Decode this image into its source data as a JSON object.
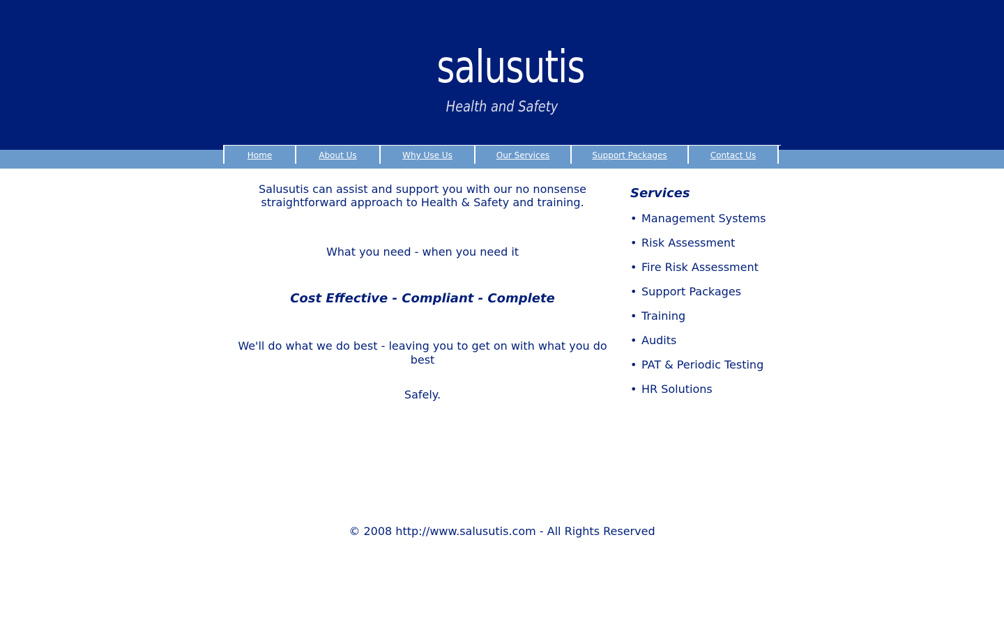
{
  "brand": {
    "logo_text": "salusutis",
    "logo_subtitle": "Health and Safety"
  },
  "nav": {
    "items": [
      {
        "label": "Home"
      },
      {
        "label": "About Us"
      },
      {
        "label": "Why Use Us"
      },
      {
        "label": "Our Services"
      },
      {
        "label": "Support Packages"
      },
      {
        "label": "Contact Us"
      }
    ]
  },
  "main": {
    "intro": "Salusutis can assist and support you with our no nonsense straightforward approach to Health & Safety and training.",
    "tagline": "What you need - when you need it",
    "strap": "Cost Effective - Compliant - Complete",
    "best_line": "We'll do what we do best - leaving you to get on with what you do best",
    "safely": "Safely."
  },
  "sidebar": {
    "title": "Services",
    "bullet": "•",
    "items": [
      {
        "label": "Management Systems"
      },
      {
        "label": "Risk Assessment"
      },
      {
        "label": "Fire Risk Assessment"
      },
      {
        "label": "Support Packages"
      },
      {
        "label": "Training"
      },
      {
        "label": "Audits"
      },
      {
        "label": "PAT & Periodic Testing"
      },
      {
        "label": "HR Solutions"
      }
    ]
  },
  "footer": {
    "text": "© 2008 http://www.salusutis.com - All Rights Reserved"
  },
  "colors": {
    "header_bg": "#001e78",
    "nav_bg": "#6a9acb",
    "text": "#001e78"
  }
}
